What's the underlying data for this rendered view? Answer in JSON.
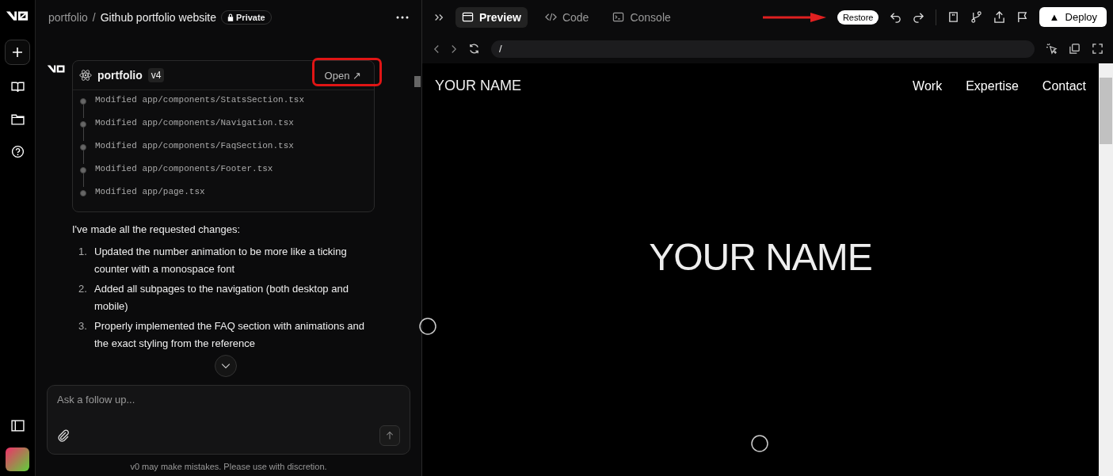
{
  "breadcrumb": {
    "project": "portfolio",
    "separator": "/",
    "chat": "Github portfolio website",
    "visibility": "Private"
  },
  "version_card": {
    "name": "portfolio",
    "version": "v4",
    "open_label": "Open ↗",
    "highlighted": true,
    "files": [
      "Modified app/components/StatsSection.tsx",
      "Modified app/components/Navigation.tsx",
      "Modified app/components/FaqSection.tsx",
      "Modified app/components/Footer.tsx",
      "Modified app/page.tsx"
    ]
  },
  "message": {
    "intro": "I've made all the requested changes:",
    "items": [
      {
        "number": "1.",
        "text": "Updated the number animation to be more like a ticking counter with a monospace font"
      },
      {
        "number": "2.",
        "text": "Added all subpages to the navigation (both desktop and mobile)"
      },
      {
        "number": "3.",
        "text": "Properly implemented the FAQ section with animations and the exact styling from the reference"
      }
    ]
  },
  "composer": {
    "placeholder": "Ask a follow up..."
  },
  "disclaimer": "v0 may make mistakes. Please use with discretion.",
  "tabs": [
    {
      "label": "Preview",
      "selected": true,
      "kind": "preview"
    },
    {
      "label": "Code",
      "selected": false,
      "kind": "code"
    },
    {
      "label": "Console",
      "selected": false,
      "kind": "console"
    }
  ],
  "restore_label": "Restore",
  "deploy_label": "Deploy",
  "deploy_glyph": "▲",
  "url": "/",
  "site": {
    "logo": "YOUR NAME",
    "nav": [
      "Work",
      "Expertise",
      "Contact"
    ],
    "hero": "YOUR NAME"
  }
}
